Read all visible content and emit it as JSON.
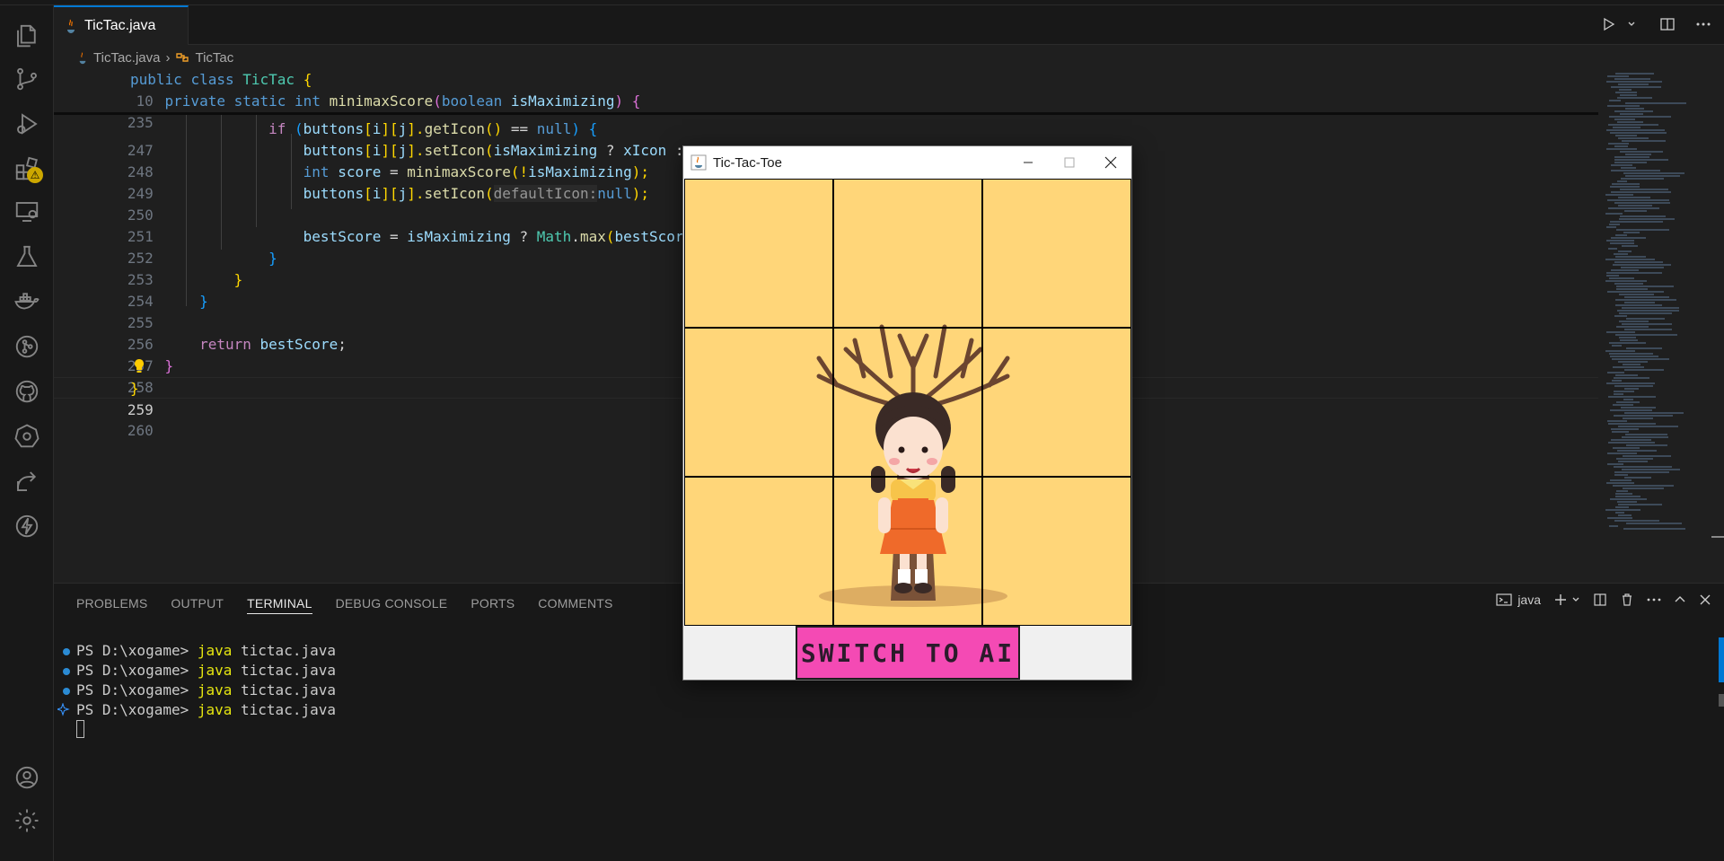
{
  "editor_tab": {
    "filename": "TicTac.java"
  },
  "breadcrumb": {
    "file": "TicTac.java",
    "symbol": "TicTac"
  },
  "code_lines": [
    {
      "num": "10"
    },
    {
      "num": "235"
    },
    {
      "num": "247"
    },
    {
      "num": "248"
    },
    {
      "num": "249"
    },
    {
      "num": "250"
    },
    {
      "num": "251"
    },
    {
      "num": "252"
    },
    {
      "num": "253"
    },
    {
      "num": "254"
    },
    {
      "num": "255"
    },
    {
      "num": "256"
    },
    {
      "num": "257"
    },
    {
      "num": "258"
    },
    {
      "num": "259"
    },
    {
      "num": "260"
    }
  ],
  "code": {
    "l10": {
      "kw1": "public",
      "kw2": "class",
      "name": "TicTac",
      "brace": "{"
    },
    "l235": {
      "kw1": "private",
      "kw2": "static",
      "kw3": "int",
      "fn": "minimaxScore",
      "p1": "(",
      "ptype": "boolean",
      "pname": "isMaximizing",
      "p2": ")",
      "brace": "{"
    },
    "l247": {
      "kw": "if",
      "t1": "(",
      "arr": "buttons",
      "t2": "[",
      "i": "i",
      "t3": "][",
      "j": "j",
      "t4": "].",
      "fn": "getIcon",
      "t5": "()",
      "op": " == ",
      "nul": "null",
      "t6": ") ",
      "brace": "{"
    },
    "l248": {
      "arr": "buttons",
      "t1": "[",
      "i": "i",
      "t2": "][",
      "j": "j",
      "t3": "].",
      "fn": "setIcon",
      "t4": "(",
      "v": "isMaximizing",
      "op": " ? ",
      "v2": "xIcon",
      "rest": " :"
    },
    "l249": {
      "kw": "int",
      "v": "score",
      "op": " = ",
      "fn": "minimaxScore",
      "t1": "(!",
      "v2": "isMaximizing",
      "t2": ");"
    },
    "l250": {
      "arr": "buttons",
      "t1": "[",
      "i": "i",
      "t2": "][",
      "j": "j",
      "t3": "].",
      "fn": "setIcon",
      "t4": "(",
      "hint": "defaultIcon:",
      "nul": "null",
      "t5": ");"
    },
    "l252": {
      "v": "bestScore",
      "op": " = ",
      "v2": "isMaximizing",
      "op2": " ? ",
      "ty": "Math",
      "dot": ".",
      "fn": "max",
      "t1": "(",
      "v3": "bestScor"
    },
    "l253": {
      "brace": "}"
    },
    "l254": {
      "brace": "}"
    },
    "l255": {
      "brace": "}"
    },
    "l257": {
      "kw": "return",
      "v": "bestScore",
      "semi": ";"
    },
    "l258": {
      "brace": "}"
    },
    "l259": {
      "brace": "}"
    }
  },
  "panel": {
    "tabs": [
      "PROBLEMS",
      "OUTPUT",
      "TERMINAL",
      "DEBUG CONSOLE",
      "PORTS",
      "COMMENTS"
    ],
    "active_tab": "TERMINAL",
    "terminal_name": "java"
  },
  "terminal": {
    "lines": [
      {
        "prompt": "PS D:\\xogame> ",
        "cmd": "java",
        "arg": " tictac.java"
      },
      {
        "prompt": "PS D:\\xogame> ",
        "cmd": "java",
        "arg": " tictac.java"
      },
      {
        "prompt": "PS D:\\xogame> ",
        "cmd": "java",
        "arg": " tictac.java"
      },
      {
        "prompt": "PS D:\\xogame> ",
        "cmd": "java",
        "arg": " tictac.java"
      }
    ]
  },
  "java_window": {
    "title": "Tic-Tac-Toe",
    "button_label": "SWITCH TO AI"
  },
  "activity_bar": {
    "badge": "⚠"
  },
  "colors": {
    "accent": "#0078d4",
    "board_bg": "#ffd679",
    "ai_button": "#f44ab4"
  }
}
